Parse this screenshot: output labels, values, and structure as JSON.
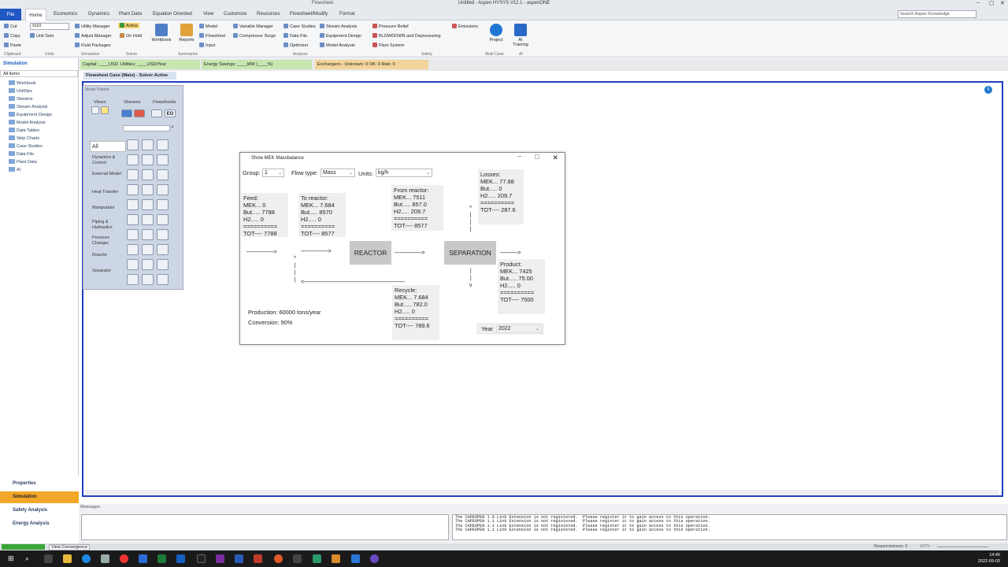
{
  "window": {
    "title": "Untitled - Aspen HYSYS V12.1 - aspenONE",
    "context_tab": "Flowsheet"
  },
  "menu_tabs": [
    "File",
    "Home",
    "Economics",
    "Dynamics",
    "Plant Data",
    "Equation Oriented",
    "View",
    "Customize",
    "Resources",
    "Flowsheet/Modify",
    "Format"
  ],
  "search_placeholder": "Search Aspen Knowledge",
  "ribbon": {
    "clipboard": {
      "cut": "Cut",
      "copy": "Copy",
      "paste": "Paste",
      "group": "Clipboard"
    },
    "units": {
      "unit_set_value": "SI10",
      "unit_sets": "Unit Sets",
      "group": "Units"
    },
    "simulation": {
      "utility_manager": "Utility Manager",
      "adjust_manager": "Adjust Manager",
      "fluid_packages": "Fluid Packages",
      "group": "Simulation"
    },
    "solver": {
      "active": "Active",
      "on_hold": "On Hold",
      "group": "Solver"
    },
    "summaries": {
      "workbook": "Workbook",
      "reports": "Reports",
      "model": "Model",
      "flowsheet": "Flowsheet",
      "input": "Input",
      "group": "Summaries"
    },
    "analysis": {
      "variable_manager": "Variable Manager",
      "compressor_surge": "Compressor Surge",
      "case_studies": "Case Studies",
      "data_fits": "Data Fits",
      "optimizer": "Optimizer",
      "stream_analysis": "Stream Analysis",
      "equipment_design": "Equipment Design",
      "model_analysis": "Model Analysis",
      "group": "Analysis"
    },
    "safety": {
      "pressure_relief": "Pressure Relief",
      "blowdown": "BLOWDOWN and Depressuring",
      "flare_system": "Flare System",
      "emissions": "Emissions",
      "group": "Safety"
    },
    "multicase": {
      "project": "Project",
      "group": "Multi Case"
    },
    "ai": {
      "ai_training": "AI Training",
      "group": "AI"
    }
  },
  "status": {
    "capital": "Capital: ____USD",
    "utilities": "Utilities: ____USD/Year",
    "energy": "Energy Savings: ____MW  (____%)",
    "exchangers": "Exchangers - Unknown: 0   OK: 0   Risk: 0"
  },
  "nav": {
    "header": "Simulation",
    "filter": "All Items",
    "items": [
      "Workbook",
      "UnitOps",
      "Streams",
      "Stream Analysis",
      "Equipment Design",
      "Model Analysis",
      "Data Tables",
      "Strip Charts",
      "Case Studies",
      "Data Fits",
      "Plant Data",
      "AI"
    ],
    "bottom": [
      "Properties",
      "Simulation",
      "Safety Analysis",
      "Energy Analysis"
    ]
  },
  "doc_tab": "Flowsheet Case (Main) - Solver Active",
  "palette": {
    "title": "Model Palette",
    "headers": [
      "Views",
      "Streams",
      "Flowsheets"
    ],
    "categories": [
      "All",
      "Dynamics & Control",
      "External Model",
      "Heat Transfer",
      "Manipulator",
      "Piping & Hydraulics",
      "Pressure Changer",
      "Reactor",
      "Separator"
    ]
  },
  "dialog": {
    "title": "Show MEK Massbalance",
    "group_label": "Group:",
    "group_value": "1",
    "flowtype_label": "Flow type:",
    "flowtype_value": "Mass",
    "units_label": "Units:",
    "units_value": "kg/h",
    "feed": [
      "Feed:",
      "MEK... 0",
      "But..... 7788",
      "H2..... 0",
      "==========",
      "TOT---- 7788"
    ],
    "to_reactor": [
      "To reactor:",
      "MEK... 7.684",
      "But..... 8570",
      "H2..... 0",
      "==========",
      "TOT---- 8577"
    ],
    "from_reactor": [
      "From reactor:",
      "MEK... 7511",
      "But..... 857.0",
      "H2..... 209.7",
      "==========",
      "TOT---- 8577"
    ],
    "losses": [
      "Losses:",
      "MEK... 77.88",
      "But..... 0",
      "H2..... 209.7",
      "==========",
      "TOT---- 287.6"
    ],
    "product": [
      "Product:",
      "MEK... 7425",
      "But..... 75.00",
      "H2..... 0",
      "==========",
      "TOT---- 7500"
    ],
    "recycle": [
      "Recycle:",
      "MEK... 7.684",
      "But..... 782.0",
      "H2..... 0",
      "==========",
      "TOT---- 789.6"
    ],
    "reactor_label": "REACTOR",
    "separation_label": "SEPARATION",
    "production": "Production: 60000 tons/year",
    "conversion": "Conversion: 90%",
    "year_label": "Year",
    "year_value": "2022"
  },
  "messages": {
    "header": "Messages",
    "lines": [
      "The CAPEOPEN 1.0 Link Extension is not registered.  Please register it to gain access to this operation.",
      "The CAPEOPEN 1.1 Link Extension is not registered.  Please register it to gain access to this operation.",
      "The CAPEOPEN 1.1 Link Extension is not registered.  Please register it to gain access to this operation.",
      "The CAPEOPEN 1.1 Link Extension is not registered.  Please register it to gain access to this operation."
    ]
  },
  "footer": {
    "view_convergence": "View Convergence",
    "responsiveness": "Responsiveness: 5",
    "zoom": "437%"
  },
  "clock": {
    "time": "14:45",
    "date": "2022-09-03"
  },
  "colors": {
    "accent": "#1f57c3",
    "canvas_border": "#1f3fbf",
    "active_nav": "#f2a72b"
  }
}
